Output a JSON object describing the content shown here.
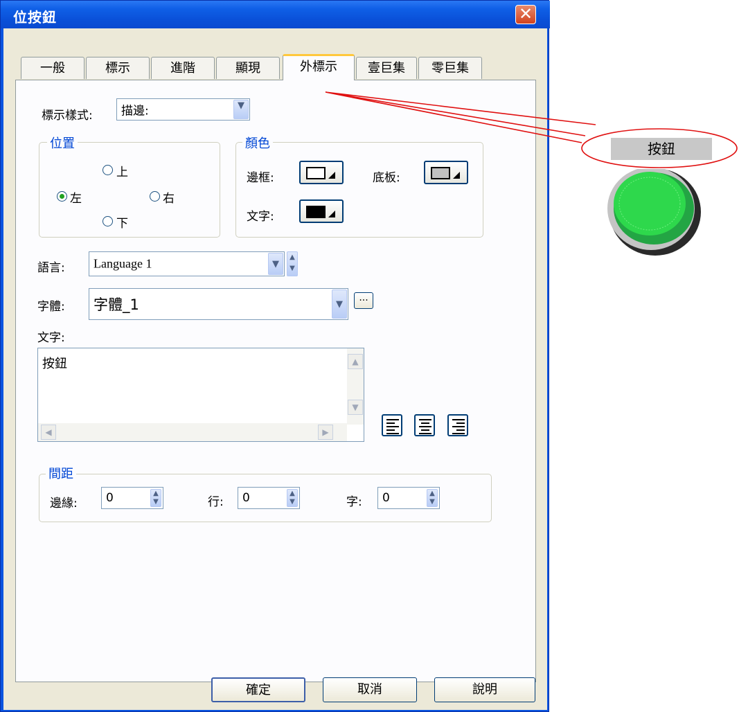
{
  "window": {
    "title": "位按鈕",
    "close_label": "✕"
  },
  "tabs": [
    {
      "label": "一般",
      "active": false
    },
    {
      "label": "標示",
      "active": false
    },
    {
      "label": "進階",
      "active": false
    },
    {
      "label": "顯現",
      "active": false
    },
    {
      "label": "外標示",
      "active": true
    },
    {
      "label": "壹巨集",
      "active": false
    },
    {
      "label": "零巨集",
      "active": false
    }
  ],
  "label_style": {
    "label": "標示樣式:",
    "value": "描邊:"
  },
  "position_group": {
    "title": "位置",
    "options": [
      {
        "label": "上",
        "checked": false
      },
      {
        "label": "左",
        "checked": true
      },
      {
        "label": "右",
        "checked": false
      },
      {
        "label": "下",
        "checked": false
      }
    ]
  },
  "color_group": {
    "title": "顏色",
    "border_label": "邊框:",
    "background_label": "底板:",
    "text_label": "文字:",
    "border_color": "#ffffff",
    "background_color": "#c0c0c0",
    "text_color": "#000000"
  },
  "language": {
    "label": "語言:",
    "value": "Language 1"
  },
  "font": {
    "label": "字體:",
    "value": "字體_1",
    "browse_label": "..."
  },
  "text": {
    "label": "文字:",
    "value": "按鈕"
  },
  "spacing_group": {
    "title": "間距",
    "margin_label": "邊緣:",
    "margin_value": "0",
    "line_label": "行:",
    "line_value": "0",
    "char_label": "字:",
    "char_value": "0"
  },
  "buttons": {
    "ok": "確定",
    "cancel": "取消",
    "help": "說明"
  },
  "preview": {
    "label_text": "按鈕",
    "button_color": "#22b93a"
  }
}
